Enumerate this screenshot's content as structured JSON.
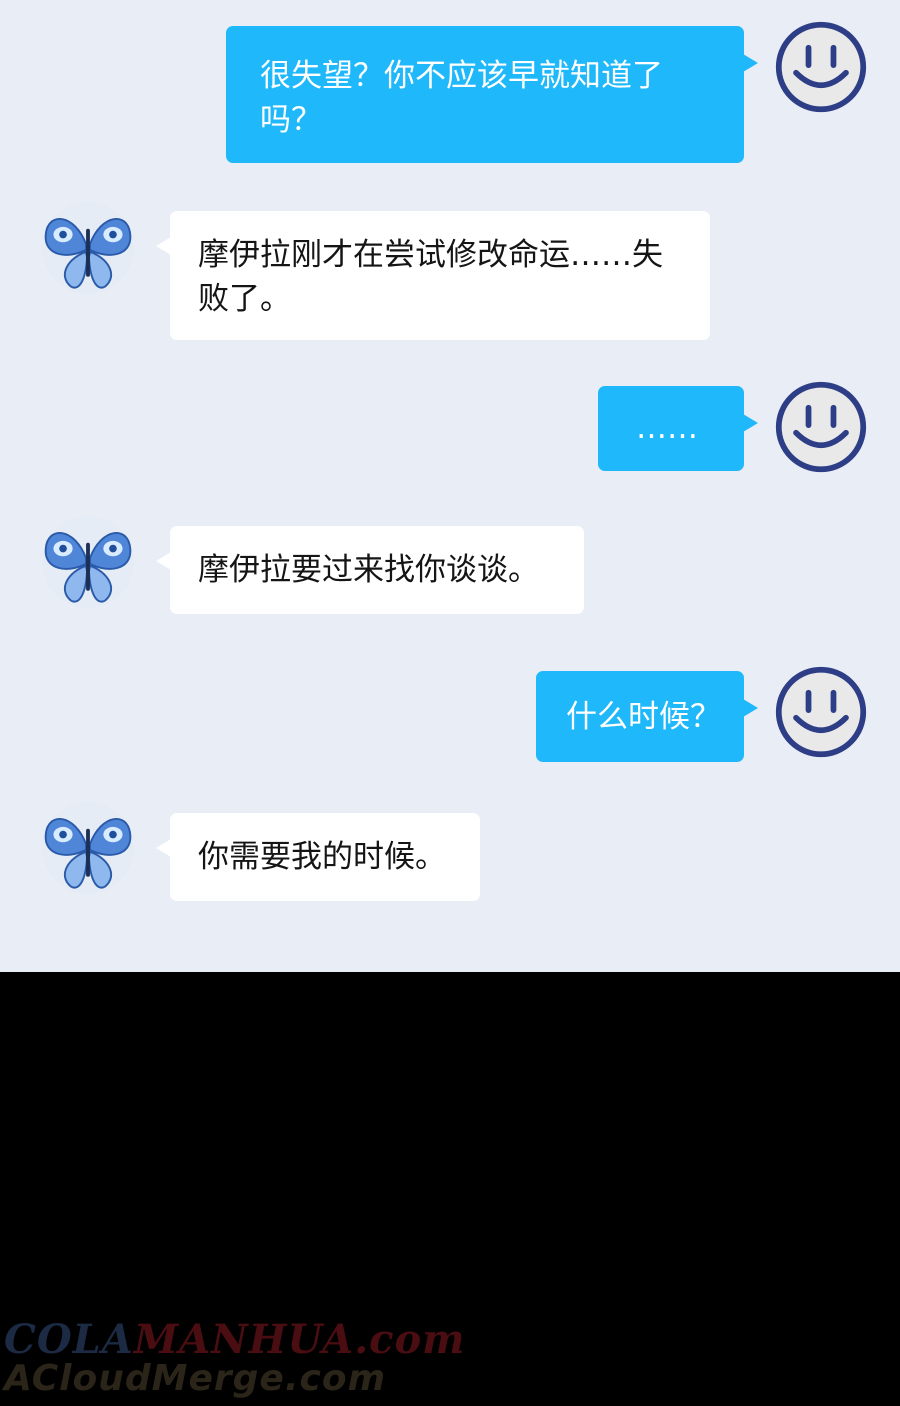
{
  "conversation": {
    "messages": [
      {
        "side": "outgoing",
        "text": "很失望？你不应该早就知道了吗？",
        "avatar_icon": "smiley-face-icon"
      },
      {
        "side": "incoming",
        "text": "摩伊拉刚才在尝试修改命运……失败了。",
        "avatar_icon": "butterfly-icon"
      },
      {
        "side": "outgoing",
        "text": "……",
        "avatar_icon": "smiley-face-icon"
      },
      {
        "side": "incoming",
        "text": "摩伊拉要过来找你谈谈。",
        "avatar_icon": "butterfly-icon"
      },
      {
        "side": "outgoing",
        "text": "什么时候？",
        "avatar_icon": "smiley-face-icon"
      },
      {
        "side": "incoming",
        "text": "你需要我的时候。",
        "avatar_icon": "butterfly-icon"
      }
    ]
  },
  "watermark": {
    "line1_prefix": "COLA",
    "line1_suffix": "MANHUA.com",
    "line2": "ACloudMerge.com"
  },
  "colors": {
    "chat_background": "#e9edf6",
    "outgoing_bubble": "#1fb8fb",
    "incoming_bubble": "#ffffff",
    "bottom_background": "#000000"
  }
}
